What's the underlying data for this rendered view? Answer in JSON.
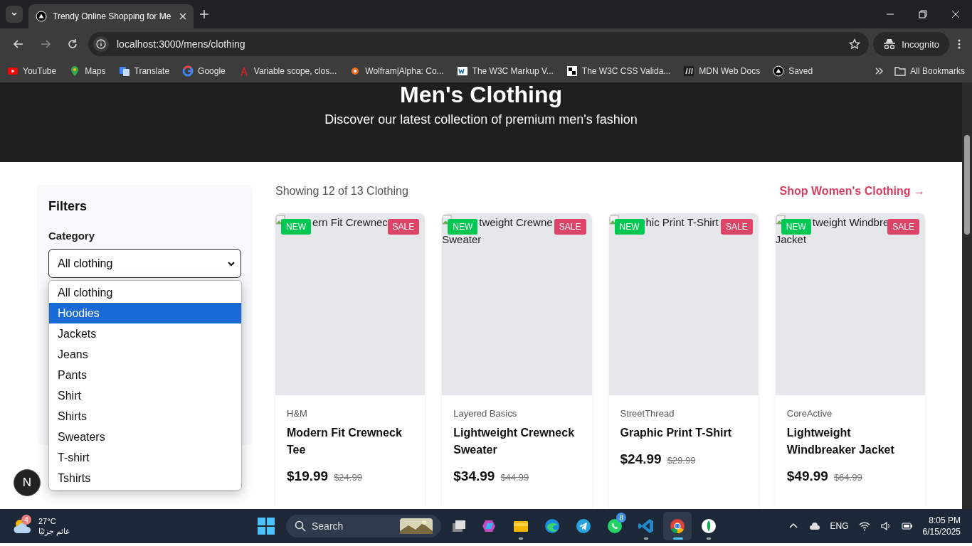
{
  "browser": {
    "tabs": [
      {
        "title": "Trendy Online Shopping for Me",
        "selected": true
      }
    ],
    "url": "localhost:3000/mens/clothing",
    "profile": "Incognito",
    "bookmarks": [
      {
        "kind": "youtube",
        "label": "YouTube"
      },
      {
        "kind": "maps",
        "label": "Maps"
      },
      {
        "kind": "translate",
        "label": "Translate"
      },
      {
        "kind": "google",
        "label": "Google"
      },
      {
        "kind": "tower",
        "label": "Variable scope, clos..."
      },
      {
        "kind": "wolfram",
        "label": "Wolfram|Alpha: Co..."
      },
      {
        "kind": "w3",
        "label": "The W3C Markup V..."
      },
      {
        "kind": "puzzle",
        "label": "The W3C CSS Valida..."
      },
      {
        "kind": "mdn",
        "label": "MDN Web Docs"
      },
      {
        "kind": "triangle",
        "label": "Saved"
      }
    ],
    "all_bookmarks": "All Bookmarks"
  },
  "hero": {
    "title": "Men's Clothing",
    "subtitle": "Discover our latest collection of premium men's fashion"
  },
  "filters": {
    "title": "Filters",
    "category_label": "Category",
    "select_value": "All clothing",
    "options": [
      {
        "label": "All clothing",
        "selected": false
      },
      {
        "label": "Hoodies",
        "selected": true
      },
      {
        "label": "Jackets",
        "selected": false
      },
      {
        "label": "Jeans",
        "selected": false
      },
      {
        "label": "Pants",
        "selected": false
      },
      {
        "label": "Shirt",
        "selected": false
      },
      {
        "label": "Shirts",
        "selected": false
      },
      {
        "label": "Sweaters",
        "selected": false
      },
      {
        "label": "T-shirt",
        "selected": false
      },
      {
        "label": "Tshirts",
        "selected": false
      }
    ]
  },
  "results": {
    "count": "Showing 12 of 13 Clothing",
    "link": "Shop Women's Clothing →"
  },
  "products": [
    {
      "image_alt": [
        "ern Fit Crewnec"
      ],
      "badges": [
        {
          "kind": "new",
          "label": "NEW"
        },
        {
          "kind": "sale",
          "label": "SALE"
        }
      ],
      "brand": "H&M",
      "name": "Modern Fit Crewneck Tee",
      "price": "$19.99",
      "old_price": "$24.99"
    },
    {
      "image_alt": [
        "tweight Crewne",
        "Sweater"
      ],
      "badges": [
        {
          "kind": "new",
          "label": "NEW"
        },
        {
          "kind": "sale",
          "label": "SALE"
        }
      ],
      "brand": "Layered Basics",
      "name": "Lightweight Crewneck Sweater",
      "price": "$34.99",
      "old_price": "$44.99"
    },
    {
      "image_alt": [
        "hic Print T-Shirt"
      ],
      "badges": [
        {
          "kind": "new",
          "label": "NEW"
        },
        {
          "kind": "sale",
          "label": "SALE"
        }
      ],
      "brand": "StreetThread",
      "name": "Graphic Print T-Shirt",
      "price": "$24.99",
      "old_price": "$29.99"
    },
    {
      "image_alt": [
        "tweight Windbre",
        "Jacket"
      ],
      "badges": [
        {
          "kind": "new",
          "label": "NEW"
        },
        {
          "kind": "sale",
          "label": "SALE"
        }
      ],
      "brand": "CoreActive",
      "name": "Lightweight Windbreaker Jacket",
      "price": "$49.99",
      "old_price": "$64.99"
    }
  ],
  "dev_badge": "N",
  "taskbar": {
    "weather_badge": "4",
    "temperature": "27°C",
    "condition": "غائم جزئيًا",
    "search": "Search",
    "apps": [
      {
        "kind": "taskview",
        "running": false,
        "selected": false
      },
      {
        "kind": "copilot",
        "running": false,
        "selected": false
      },
      {
        "kind": "files",
        "running": true,
        "selected": false
      },
      {
        "kind": "edge",
        "running": false,
        "selected": false
      },
      {
        "kind": "telegram",
        "running": false,
        "selected": false
      },
      {
        "kind": "whatsapp",
        "running": false,
        "selected": false,
        "badge": "8"
      },
      {
        "kind": "vscode",
        "running": true,
        "selected": false
      },
      {
        "kind": "chrome",
        "running": true,
        "selected": true
      },
      {
        "kind": "leaf",
        "running": true,
        "selected": false
      }
    ],
    "language": "ENG",
    "time": "8:05 PM",
    "date": "6/15/2025"
  }
}
